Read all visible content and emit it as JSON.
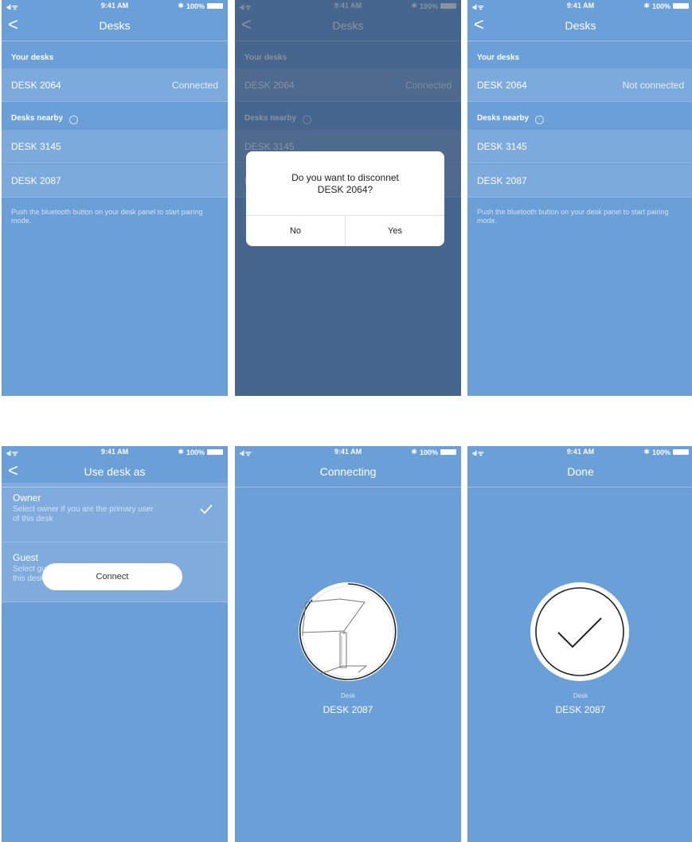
{
  "status_bar": {
    "signal": "•ıl",
    "wifi": "ᯤ",
    "time": "9:41 AM",
    "bluetooth": "✱",
    "battery": "100%"
  },
  "screen1": {
    "title": "Desks",
    "your_desks_header": "Your desks",
    "my_desk": {
      "name": "DESK 2064",
      "status": "Connected"
    },
    "nearby_header": "Desks nearby",
    "nearby": [
      "DESK 3145",
      "DESK 2087"
    ],
    "hint": "Push the bluetooth button on your desk panel to start pairing mode."
  },
  "screen2": {
    "dialog_line1": "Do you want to disconnet",
    "dialog_line2": "DESK 2064?",
    "no_label": "No",
    "yes_label": "Yes"
  },
  "screen3": {
    "title": "Desks",
    "your_desks_header": "Your desks",
    "my_desk": {
      "name": "DESK 2064",
      "status": "Not connected"
    },
    "nearby_header": "Desks nearby",
    "nearby": [
      "DESK 3145",
      "DESK 2087"
    ],
    "hint": "Push the bluetooth button on your desk panel to start pairing mode."
  },
  "screen4": {
    "title": "Use desk as",
    "owner": {
      "name": "Owner",
      "desc": "Select owner if you are the primary user of this desk",
      "selected": true
    },
    "guest": {
      "name": "Guest",
      "desc": "Select guest if you are temporarily using this desk",
      "selected": false
    },
    "connect_label": "Connect"
  },
  "screen5": {
    "title": "Connecting",
    "caption": "Desk",
    "desk_name": "DESK 2087"
  },
  "screen6": {
    "title": "Done",
    "caption": "Desk",
    "desk_name": "DESK 2087"
  },
  "colors": {
    "background": "#6a9fd8",
    "overlay": "#37506e",
    "dialog": "#ffffff"
  }
}
